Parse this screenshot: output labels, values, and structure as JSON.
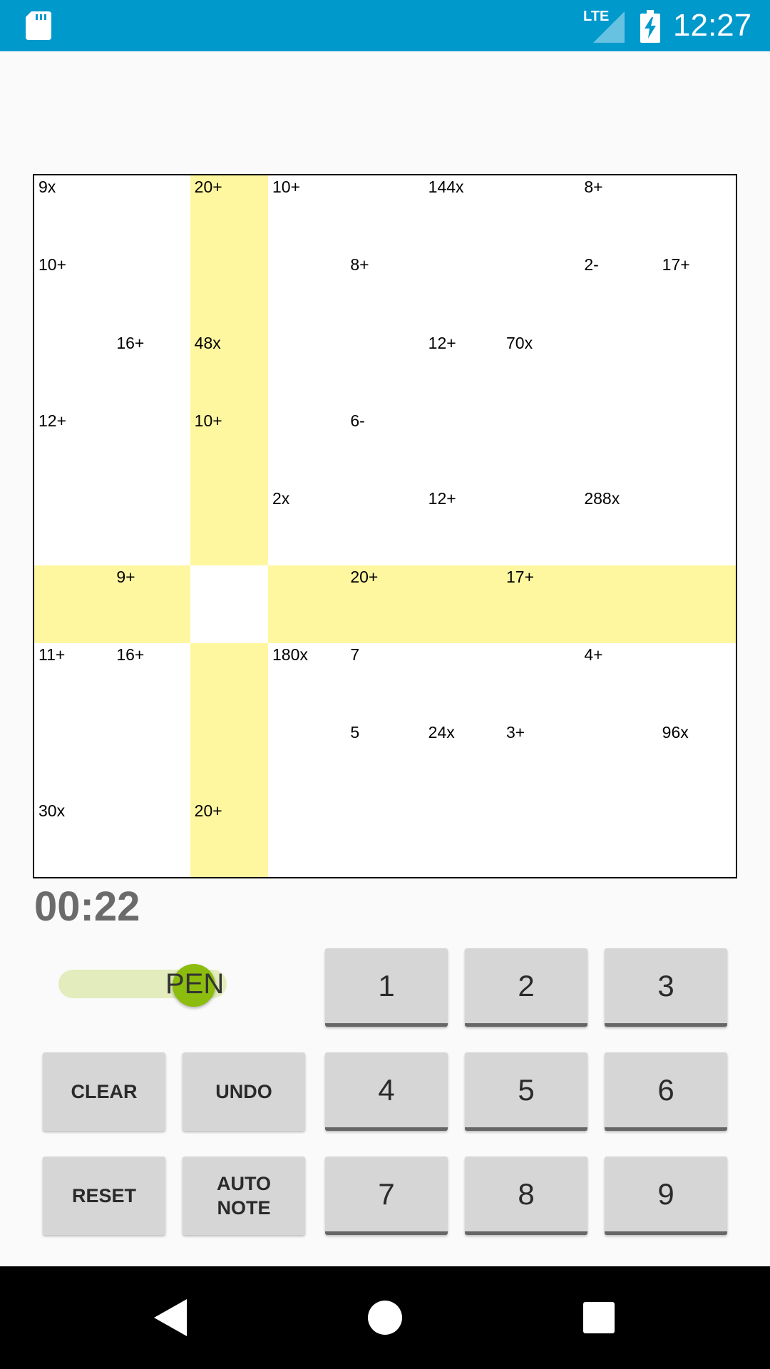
{
  "status_bar": {
    "time": "12:27",
    "network": "LTE",
    "color": "#0099cc"
  },
  "puzzle": {
    "size": 9,
    "cages": [
      {
        "label": "9x",
        "cells": [
          [
            0,
            0
          ],
          [
            0,
            1
          ],
          [
            1,
            1
          ]
        ]
      },
      {
        "label": "20+",
        "cells": [
          [
            0,
            2
          ],
          [
            1,
            2
          ],
          [
            0,
            3
          ]
        ]
      },
      {
        "label": "10+",
        "cells": [
          [
            0,
            3
          ],
          [
            0,
            4
          ]
        ]
      },
      {
        "label": "144x",
        "cells": [
          [
            0,
            5
          ],
          [
            0,
            6
          ],
          [
            1,
            6
          ]
        ]
      },
      {
        "label": "8+",
        "cells": [
          [
            0,
            7
          ],
          [
            0,
            8
          ]
        ]
      },
      {
        "label": "10+",
        "cells": [
          [
            1,
            0
          ],
          [
            2,
            0
          ]
        ]
      },
      {
        "label": "8+",
        "cells": [
          [
            1,
            4
          ],
          [
            1,
            5
          ],
          [
            2,
            4
          ],
          [
            3,
            4
          ]
        ]
      },
      {
        "label": "2-",
        "cells": [
          [
            1,
            7
          ],
          [
            2,
            7
          ]
        ]
      },
      {
        "label": "17+",
        "cells": [
          [
            1,
            8
          ],
          [
            2,
            8
          ],
          [
            3,
            8
          ]
        ]
      },
      {
        "label": "16+",
        "cells": [
          [
            2,
            1
          ],
          [
            3,
            1
          ],
          [
            4,
            1
          ]
        ]
      },
      {
        "label": "48x",
        "cells": [
          [
            2,
            2
          ],
          [
            2,
            3
          ]
        ]
      },
      {
        "label": "12+",
        "cells": [
          [
            2,
            5
          ],
          [
            3,
            5
          ]
        ]
      },
      {
        "label": "70x",
        "cells": [
          [
            2,
            6
          ],
          [
            3,
            6
          ],
          [
            3,
            7
          ]
        ]
      },
      {
        "label": "12+",
        "cells": [
          [
            3,
            0
          ],
          [
            4,
            0
          ],
          [
            5,
            0
          ]
        ]
      },
      {
        "label": "10+",
        "cells": [
          [
            3,
            2
          ],
          [
            3,
            3
          ],
          [
            4,
            2
          ]
        ]
      },
      {
        "label": "6-",
        "cells": [
          [
            3,
            4
          ],
          [
            4,
            4
          ]
        ]
      },
      {
        "label": "2x",
        "cells": [
          [
            4,
            3
          ],
          [
            5,
            3
          ]
        ]
      },
      {
        "label": "12+",
        "cells": [
          [
            4,
            5
          ],
          [
            4,
            6
          ]
        ]
      },
      {
        "label": "288x",
        "cells": [
          [
            4,
            7
          ],
          [
            4,
            8
          ],
          [
            5,
            8
          ]
        ]
      },
      {
        "label": "9+",
        "cells": [
          [
            5,
            1
          ],
          [
            5,
            2
          ]
        ]
      },
      {
        "label": "20+",
        "cells": [
          [
            5,
            4
          ],
          [
            5,
            5
          ],
          [
            6,
            5
          ]
        ]
      },
      {
        "label": "17+",
        "cells": [
          [
            5,
            6
          ],
          [
            5,
            7
          ],
          [
            6,
            6
          ]
        ]
      },
      {
        "label": "11+",
        "cells": [
          [
            6,
            0
          ],
          [
            7,
            0
          ]
        ]
      },
      {
        "label": "16+",
        "cells": [
          [
            6,
            1
          ],
          [
            7,
            1
          ]
        ]
      },
      {
        "label": "180x",
        "cells": [
          [
            6,
            3
          ],
          [
            7,
            3
          ]
        ]
      },
      {
        "label": "7",
        "cells": [
          [
            6,
            4
          ]
        ]
      },
      {
        "label": "4+",
        "cells": [
          [
            6,
            7
          ],
          [
            6,
            8
          ]
        ]
      },
      {
        "label": "5",
        "cells": [
          [
            7,
            4
          ]
        ]
      },
      {
        "label": "24x",
        "cells": [
          [
            7,
            5
          ],
          [
            8,
            5
          ]
        ]
      },
      {
        "label": "3+",
        "cells": [
          [
            7,
            6
          ],
          [
            7,
            7
          ]
        ]
      },
      {
        "label": "96x",
        "cells": [
          [
            7,
            8
          ],
          [
            8,
            8
          ]
        ]
      },
      {
        "label": "30x",
        "cells": [
          [
            8,
            0
          ],
          [
            8,
            1
          ]
        ]
      },
      {
        "label": "20+",
        "cells": [
          [
            8,
            2
          ],
          [
            8,
            3
          ],
          [
            8,
            4
          ]
        ]
      }
    ],
    "selected_cell": [
      5,
      2
    ],
    "highlight_color": "#fff7a0",
    "selected_border_color": "#7fbf1a"
  },
  "timer": "00:22",
  "pen_toggle": {
    "label": "PEN",
    "knob_color": "#8cbd0e",
    "track_color": "#e2ecbc"
  },
  "controls": {
    "clear": "CLEAR",
    "undo": "UNDO",
    "reset": "RESET",
    "auto_note": "AUTO\nNOTE"
  },
  "numbers": [
    "1",
    "2",
    "3",
    "4",
    "5",
    "6",
    "7",
    "8",
    "9"
  ]
}
